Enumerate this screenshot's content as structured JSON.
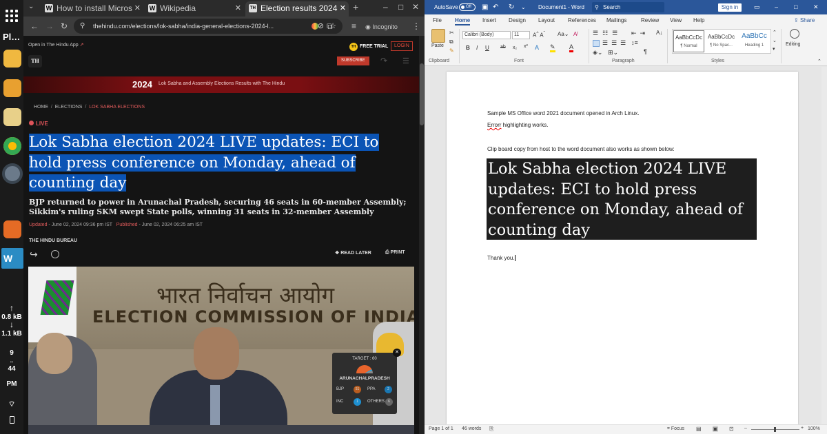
{
  "dock": {
    "title": "Pl…",
    "net_up": "0.8 kB",
    "net_down": "1.1 kB",
    "time_hour": "9",
    "time_min": "44",
    "time_ampm": "PM"
  },
  "browser": {
    "tabs": [
      {
        "label": "How to install Micros",
        "favicon": "W"
      },
      {
        "label": "Wikipedia",
        "favicon": "W"
      },
      {
        "label": "Election results 2024",
        "favicon": "TH"
      }
    ],
    "url": "thehindu.com/elections/lok-sabha/india-general-elections-2024-l...",
    "incognito_label": "Incognito",
    "site": {
      "open_app": "Open in The Hindu App",
      "free_trial": "FREE TRIAL",
      "login": "LOGIN",
      "logo": "TH",
      "subscribe": "SUBSCRIBE",
      "banner_year": "2024",
      "banner_text": "Lok Sabha and Assembly Elections Results with The Hindu",
      "breadcrumbs": [
        "HOME",
        "ELECTIONS",
        "LOK SABHA ELECTIONS"
      ],
      "live_label": "LIVE",
      "headline": "Lok Sabha election 2024 LIVE updates: ECI to hold press conference on Monday, ahead of counting day",
      "subhead": "BJP returned to power in Arunachal Pradesh, securing 46 seats in 60-member Assembly; Sikkim's ruling SKM swept State polls, winning 31 seats in 32-member Assembly",
      "updated_label": "Updated",
      "updated_value": "- June 02, 2024 09:36 pm IST",
      "published_label": "Published",
      "published_value": "- June 02, 2024 06:25 am IST",
      "author": "THE HINDU BUREAU",
      "read_later": "READ LATER",
      "print": "PRINT",
      "photo_hindi": "भारत निर्वाचन आयोग",
      "photo_english": "ELECTION COMMISSION OF INDIA",
      "widget": {
        "target": "TARGET : 60",
        "state": "ARUNACHALPRADESH",
        "rows": [
          {
            "party": "BJP",
            "value": "51",
            "party2": "PPA",
            "value2": "2"
          },
          {
            "party": "INC",
            "value": "1",
            "party2": "OTHERS",
            "value2": "6"
          }
        ]
      }
    }
  },
  "word": {
    "autosave": "AutoSave",
    "autosave_state": "Off",
    "doc_title": "Document1 - Word",
    "search": "Search",
    "signin": "Sign in",
    "menu_tabs": [
      "File",
      "Home",
      "Insert",
      "Design",
      "Layout",
      "References",
      "Mailings",
      "Review",
      "View",
      "Help"
    ],
    "share": "Share",
    "font_name": "Calibri (Body)",
    "font_size": "11",
    "groups": [
      "Clipboard",
      "Font",
      "Paragraph",
      "Styles"
    ],
    "paste": "Paste",
    "editing": "Editing",
    "styles": [
      {
        "preview": "AaBbCcDc",
        "name": "¶ Normal"
      },
      {
        "preview": "AaBbCcDc",
        "name": "¶ No Spac..."
      },
      {
        "preview": "AaBbCc",
        "name": "Heading 1"
      }
    ],
    "doc": {
      "line1": "Sample MS Office word 2021 document opened in Arch Linux.",
      "line2_err": "Errorr",
      "line2_rest": " highlighting works.",
      "line3": "Clip board copy from host to the word document also works as shown below:",
      "pasted": "Lok Sabha election 2024 LIVE updates: ECI to hold press conference on Monday, ahead of counting day",
      "thanks": "Thank you."
    },
    "status": {
      "page": "Page 1 of 1",
      "words": "46 words",
      "focus": "Focus",
      "zoom": "100%"
    }
  }
}
